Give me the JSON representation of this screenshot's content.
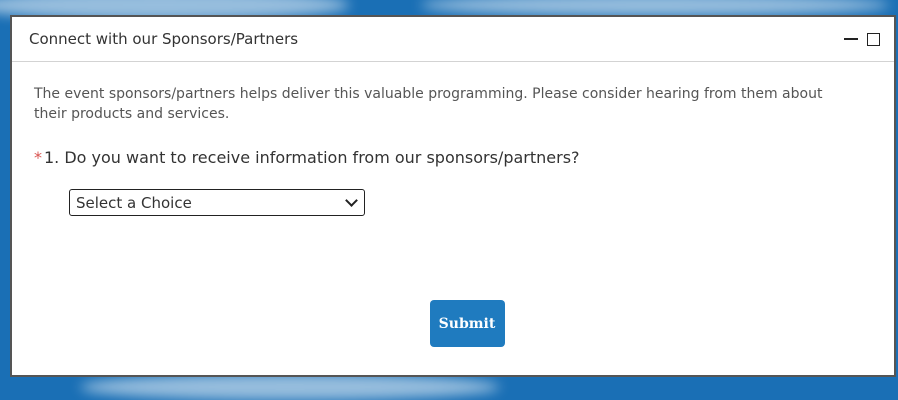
{
  "panel": {
    "title": "Connect with our Sponsors/Partners",
    "intro": "The event sponsors/partners helps deliver this valuable programming. Please consider hearing from them about their products and services."
  },
  "question": {
    "required_mark": "*",
    "text": "1. Do you want to receive information from our sponsors/partners?"
  },
  "select": {
    "value": "Select a Choice"
  },
  "submit": {
    "label": "Submit"
  },
  "icons": {
    "minimize": "minimize-icon",
    "maximize": "maximize-icon",
    "dropdown": "chevron-down-icon"
  },
  "colors": {
    "accent": "#1f7bbf",
    "required": "#d9534f"
  }
}
